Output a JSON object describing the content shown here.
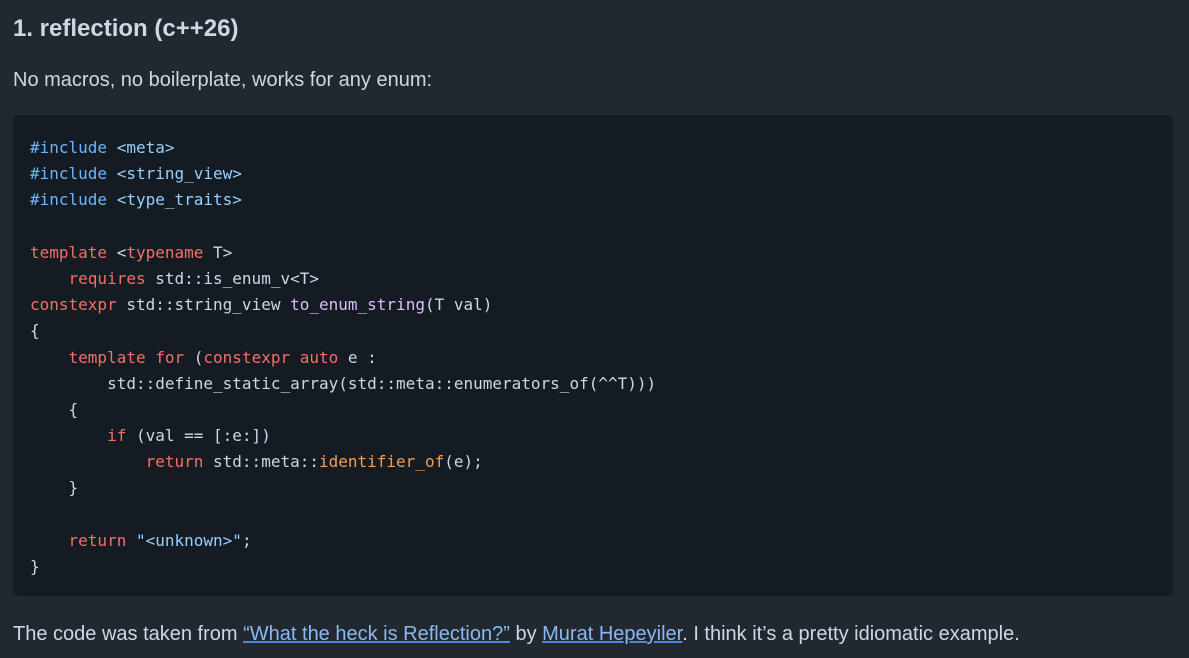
{
  "heading": "1. reflection (c++26)",
  "intro": "No macros, no boilerplate, works for any enum:",
  "code": {
    "language": "cpp",
    "lines": [
      [
        {
          "t": "pp",
          "s": "#include"
        },
        {
          "t": "plain",
          "s": " "
        },
        {
          "t": "str",
          "s": "<meta>"
        }
      ],
      [
        {
          "t": "pp",
          "s": "#include"
        },
        {
          "t": "plain",
          "s": " "
        },
        {
          "t": "str",
          "s": "<string_view>"
        }
      ],
      [
        {
          "t": "pp",
          "s": "#include"
        },
        {
          "t": "plain",
          "s": " "
        },
        {
          "t": "str",
          "s": "<type_traits>"
        }
      ],
      [],
      [
        {
          "t": "kw",
          "s": "template"
        },
        {
          "t": "plain",
          "s": " <"
        },
        {
          "t": "kw",
          "s": "typename"
        },
        {
          "t": "plain",
          "s": " T>"
        }
      ],
      [
        {
          "t": "plain",
          "s": "    "
        },
        {
          "t": "kw",
          "s": "requires"
        },
        {
          "t": "plain",
          "s": " std::is_enum_v<T>"
        }
      ],
      [
        {
          "t": "kw",
          "s": "constexpr"
        },
        {
          "t": "plain",
          "s": " std::string_view "
        },
        {
          "t": "fn",
          "s": "to_enum_string"
        },
        {
          "t": "plain",
          "s": "(T val)"
        }
      ],
      [
        {
          "t": "plain",
          "s": "{"
        }
      ],
      [
        {
          "t": "plain",
          "s": "    "
        },
        {
          "t": "kw",
          "s": "template"
        },
        {
          "t": "plain",
          "s": " "
        },
        {
          "t": "kw",
          "s": "for"
        },
        {
          "t": "plain",
          "s": " ("
        },
        {
          "t": "kw",
          "s": "constexpr"
        },
        {
          "t": "plain",
          "s": " "
        },
        {
          "t": "kw",
          "s": "auto"
        },
        {
          "t": "plain",
          "s": " e :"
        }
      ],
      [
        {
          "t": "plain",
          "s": "        std::define_static_array(std::meta::enumerators_of(^^T)))"
        }
      ],
      [
        {
          "t": "plain",
          "s": "    {"
        }
      ],
      [
        {
          "t": "plain",
          "s": "        "
        },
        {
          "t": "kw",
          "s": "if"
        },
        {
          "t": "plain",
          "s": " (val == [:e:])"
        }
      ],
      [
        {
          "t": "plain",
          "s": "            "
        },
        {
          "t": "kw",
          "s": "return"
        },
        {
          "t": "plain",
          "s": " std::meta::"
        },
        {
          "t": "id",
          "s": "identifier_of"
        },
        {
          "t": "plain",
          "s": "(e);"
        }
      ],
      [
        {
          "t": "plain",
          "s": "    }"
        }
      ],
      [],
      [
        {
          "t": "plain",
          "s": "    "
        },
        {
          "t": "kw",
          "s": "return"
        },
        {
          "t": "plain",
          "s": " "
        },
        {
          "t": "str",
          "s": "\"<unknown>\""
        },
        {
          "t": "plain",
          "s": ";"
        }
      ],
      [
        {
          "t": "plain",
          "s": "}"
        }
      ]
    ]
  },
  "footer": {
    "prefix": "The code was taken from ",
    "link1_text": "“What the heck is Reflection?”",
    "middle": " by ",
    "link2_text": "Murat Hepeyiler",
    "suffix": ". I think it’s a pretty idiomatic example."
  },
  "colors": {
    "background": "#212830",
    "code_background": "#151b23",
    "text": "#d1d7e0",
    "keyword": "#f47067",
    "function": "#dcbdfb",
    "string": "#96d0ff",
    "identifier": "#f69d50",
    "link": "#478be6"
  }
}
